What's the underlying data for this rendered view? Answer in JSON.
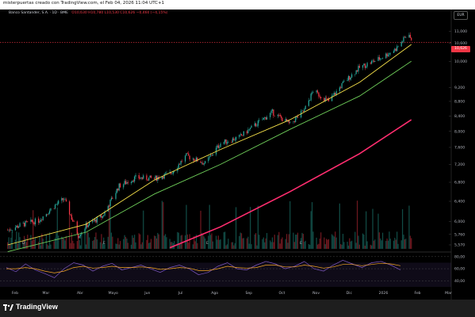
{
  "header": {
    "watermark": "misterpuertas creado con TradingView.com, el Feb 04, 2026 11:04 UTC+1",
    "symbol": "Banco Santander, S.A. · 1D · BME",
    "ohlc": "O10,630 H10,780 L10,530 C10,626 −0,460 (−4,15%)"
  },
  "currency_button": "EUR",
  "last_price_label": "10,626",
  "footer": {
    "brand": "TradingView"
  },
  "colors": {
    "up": "#26a69a",
    "down": "#f23645",
    "ema_fast": "#f7e24a",
    "ema_mid": "#6fcf5a",
    "ema_slow": "#ff2d6f",
    "rsi_line": "#7e57c2",
    "rsi_signal": "#f5a623",
    "price_line": "#f23645"
  },
  "chart_data": [
    {
      "type": "candlestick",
      "title": "Banco Santander, S.A. · 1D · BME",
      "y_scale": "log",
      "yticks": [
        11.0,
        10.6,
        10.0,
        9.2,
        8.8,
        8.4,
        8.0,
        7.6,
        7.2,
        6.8,
        6.4,
        6.0,
        5.76,
        5.57
      ],
      "ytick_labels": [
        "11,000",
        "10,600",
        "10,000",
        "9,200",
        "8,800",
        "8,400",
        "8,000",
        "7,600",
        "7,200",
        "6,800",
        "6,400",
        "6,000",
        "5,760",
        "5,570"
      ],
      "ylim": [
        5.5,
        11.5
      ],
      "x_tick_labels": [
        "Feb",
        "Mar",
        "Abr",
        "Mayo",
        "Jun",
        "Jul",
        "Ago",
        "Sep",
        "Oct",
        "Nov",
        "Dic",
        "2026",
        "Feb",
        "Mar"
      ],
      "ohlc_points": [
        [
          "2025-02-03",
          5.84
        ],
        [
          "2025-02-17",
          5.95
        ],
        [
          "2025-03-03",
          6.02
        ],
        [
          "2025-03-17",
          6.3
        ],
        [
          "2025-03-26",
          6.45
        ],
        [
          "2025-04-08",
          5.74
        ],
        [
          "2025-04-15",
          5.92
        ],
        [
          "2025-04-30",
          6.1
        ],
        [
          "2025-05-15",
          6.72
        ],
        [
          "2025-05-30",
          6.9
        ],
        [
          "2025-06-16",
          6.88
        ],
        [
          "2025-07-01",
          7.0
        ],
        [
          "2025-07-15",
          7.4
        ],
        [
          "2025-08-01",
          7.22
        ],
        [
          "2025-08-15",
          7.7
        ],
        [
          "2025-09-01",
          7.85
        ],
        [
          "2025-09-15",
          8.15
        ],
        [
          "2025-10-01",
          8.5
        ],
        [
          "2025-10-17",
          8.18
        ],
        [
          "2025-10-30",
          8.55
        ],
        [
          "2025-11-07",
          9.1
        ],
        [
          "2025-11-21",
          8.8
        ],
        [
          "2025-12-05",
          9.35
        ],
        [
          "2025-12-19",
          9.8
        ],
        [
          "2026-01-07",
          10.1
        ],
        [
          "2026-01-21",
          10.4
        ],
        [
          "2026-02-02",
          10.95
        ],
        [
          "2026-02-04",
          10.626
        ]
      ],
      "ema_fast": [
        [
          "2025-02-03",
          5.57
        ],
        [
          "2025-04-15",
          5.95
        ],
        [
          "2025-06-16",
          6.85
        ],
        [
          "2025-08-15",
          7.55
        ],
        [
          "2025-10-17",
          8.3
        ],
        [
          "2025-12-19",
          9.35
        ],
        [
          "2026-02-04",
          10.55
        ]
      ],
      "ema_mid": [
        [
          "2025-02-03",
          5.45
        ],
        [
          "2025-04-15",
          5.8
        ],
        [
          "2025-06-16",
          6.55
        ],
        [
          "2025-08-15",
          7.2
        ],
        [
          "2025-10-17",
          8.05
        ],
        [
          "2025-12-19",
          8.95
        ],
        [
          "2026-02-04",
          10.0
        ]
      ],
      "ema_slow": [
        [
          "2025-06-30",
          5.52
        ],
        [
          "2025-08-15",
          5.9
        ],
        [
          "2025-10-17",
          6.6
        ],
        [
          "2025-12-19",
          7.45
        ],
        [
          "2026-02-04",
          8.3
        ]
      ],
      "last_price": 10.626
    },
    {
      "type": "line",
      "title": "RSI",
      "yticks": [
        80,
        60,
        40
      ],
      "ytick_labels": [
        "80,00",
        "60,00",
        "40,00"
      ],
      "ylim": [
        30,
        85
      ],
      "series": [
        {
          "values": [
            62,
            55,
            68,
            58,
            52,
            45,
            60,
            70,
            66,
            56,
            64,
            69,
            58,
            62,
            66,
            60,
            54,
            62,
            66,
            60,
            50,
            54,
            64,
            70,
            60,
            58,
            66,
            72,
            68,
            60,
            64,
            72,
            60,
            56,
            66,
            74,
            68,
            62,
            70,
            72,
            66,
            58
          ]
        },
        {
          "values": [
            60,
            60,
            62,
            60,
            56,
            53,
            56,
            62,
            64,
            61,
            62,
            64,
            62,
            62,
            63,
            62,
            59,
            60,
            62,
            61,
            57,
            57,
            60,
            64,
            62,
            61,
            62,
            66,
            66,
            63,
            63,
            66,
            64,
            61,
            63,
            67,
            67,
            65,
            67,
            69,
            68,
            65
          ]
        }
      ]
    }
  ]
}
